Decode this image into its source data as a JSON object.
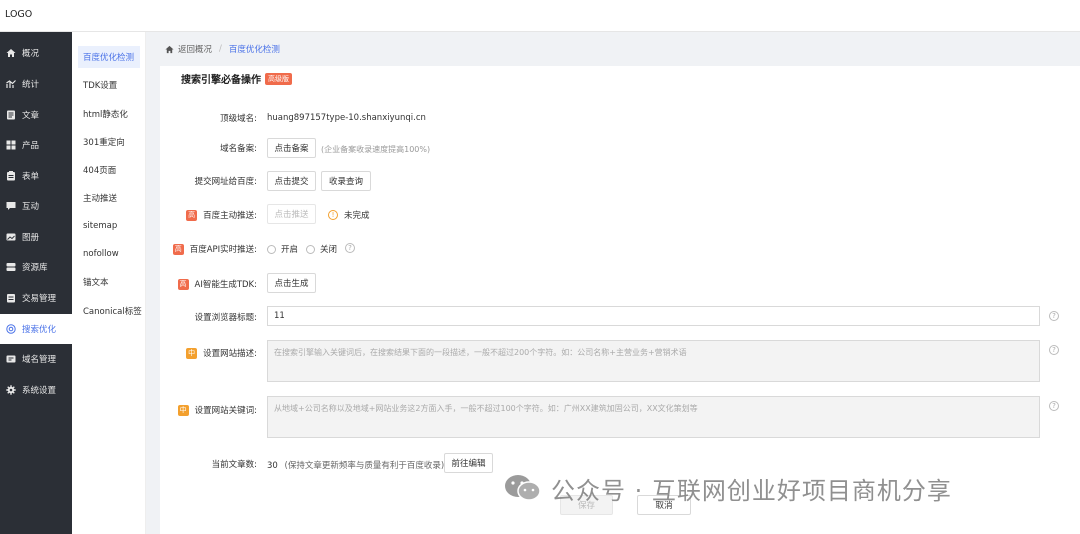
{
  "header": {
    "logo": "LOGO"
  },
  "sidebar": {
    "items": [
      {
        "label": "概况",
        "icon": "home-icon"
      },
      {
        "label": "统计",
        "icon": "chart-icon"
      },
      {
        "label": "文章",
        "icon": "article-icon"
      },
      {
        "label": "产品",
        "icon": "grid-icon"
      },
      {
        "label": "表单",
        "icon": "form-icon"
      },
      {
        "label": "互动",
        "icon": "chat-icon"
      },
      {
        "label": "图册",
        "icon": "album-icon"
      },
      {
        "label": "资源库",
        "icon": "storage-icon"
      },
      {
        "label": "交易管理",
        "icon": "trade-icon"
      },
      {
        "label": "搜索优化",
        "icon": "seo-icon",
        "active": true
      },
      {
        "label": "域名管理",
        "icon": "domain-icon"
      },
      {
        "label": "系统设置",
        "icon": "gear-icon"
      }
    ]
  },
  "subnav": {
    "items": [
      {
        "label": "百度优化检测",
        "active": true
      },
      {
        "label": "TDK设置"
      },
      {
        "label": "html静态化"
      },
      {
        "label": "301重定向"
      },
      {
        "label": "404页面"
      },
      {
        "label": "主动推送"
      },
      {
        "label": "sitemap"
      },
      {
        "label": "nofollow"
      },
      {
        "label": "锚文本"
      },
      {
        "label": "Canonical标签"
      }
    ]
  },
  "breadcrumb": {
    "back": "返回概况",
    "sep": "/",
    "current": "百度优化检测"
  },
  "panel": {
    "title": "搜索引擎必备操作",
    "title_tag": "高级版",
    "top_domain_label": "顶级域名:",
    "top_domain_value": "huang897157type-10.shanxiyunqi.cn",
    "icp_label": "域名备案:",
    "icp_button": "点击备案",
    "icp_hint": "(企业备案收录速度提高100%)",
    "submit_label": "提交网址给百度:",
    "submit_button": "点击提交",
    "index_query_button": "收录查询",
    "push_badge": "高",
    "push_label": "百度主动推送:",
    "push_button": "点击推送",
    "push_status": "未完成",
    "api_badge": "高",
    "api_label": "百度API实时推送:",
    "api_on": "开启",
    "api_off": "关闭",
    "ai_badge": "高",
    "ai_label": "AI智能生成TDK:",
    "ai_button": "点击生成",
    "browser_title_label": "设置浏览器标题:",
    "browser_title_value": "11",
    "desc_badge": "中",
    "desc_label": "设置网站描述:",
    "desc_placeholder": "在搜索引擎输入关键词后，在搜索结果下面的一段描述，一般不超过200个字符。如：公司名称+主营业务+营销术语",
    "kw_badge": "中",
    "kw_label": "设置网站关键词:",
    "kw_placeholder": "从地域+公司名称以及地域+网站业务这2方面入手，一般不超过100个字符。如：广州XX建筑加固公司，XX文化策划等",
    "article_count_label": "当前文章数:",
    "article_count_value": "30",
    "article_hint": "(保持文章更新频率与质量有利于百度收录)",
    "goto_edit_button": "前往编辑",
    "save_button": "保存",
    "cancel_button": "取消"
  },
  "watermark": {
    "text": "公众号 · 互联网创业好项目商机分享"
  }
}
